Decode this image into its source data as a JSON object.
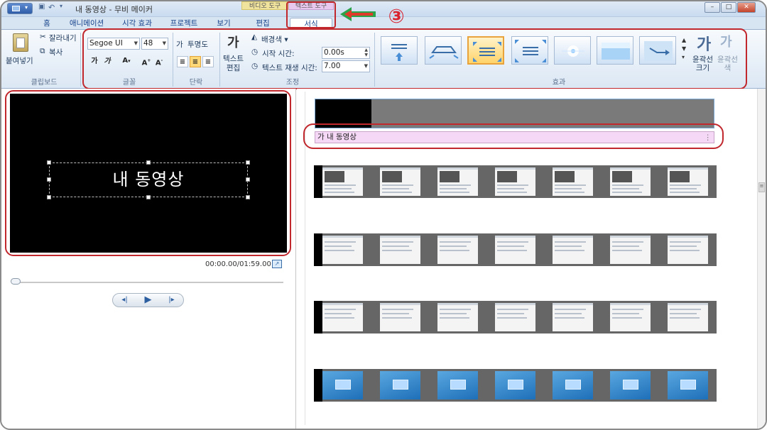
{
  "window": {
    "title": "내 동영상 - 무비 메이커",
    "context_tabs": [
      "비디오 도구",
      "텍스트 도구"
    ]
  },
  "tabs": [
    "홈",
    "애니메이션",
    "시각 효과",
    "프로젝트",
    "보기",
    "편집",
    "서식"
  ],
  "active_tab": "서식",
  "annotation": {
    "step": "③"
  },
  "clipboard": {
    "paste": "붙여넣기",
    "cut": "잘라내기",
    "copy": "복사",
    "label": "클립보드"
  },
  "font": {
    "family": "Segoe UI",
    "size": "48",
    "label": "글꼴"
  },
  "paragraph": {
    "transparency": "투명도",
    "label": "단락"
  },
  "adjust": {
    "edit_text": "텍스트\n편집",
    "bg_color": "배경색",
    "start_time_label": "시작 시간:",
    "start_time": "0.00s",
    "duration_label": "텍스트 재생 시간:",
    "duration": "7.00",
    "label": "조정"
  },
  "effects": {
    "label": "효과",
    "selected_index": 2,
    "outline_size": "윤곽선\n크기",
    "outline_color": "윤곽선\n색"
  },
  "preview": {
    "caption": "내 동영상",
    "timecode": "00:00.00/01:59.00"
  },
  "storyboard": {
    "text_clip": "가 내 동영상",
    "strips": [
      {
        "kind": "web"
      },
      {
        "kind": "doc"
      },
      {
        "kind": "doc"
      },
      {
        "kind": "desk"
      }
    ]
  },
  "colors": {
    "callout": "#c0282e",
    "arrow": "#2aa34a",
    "accent": "#15428b"
  }
}
